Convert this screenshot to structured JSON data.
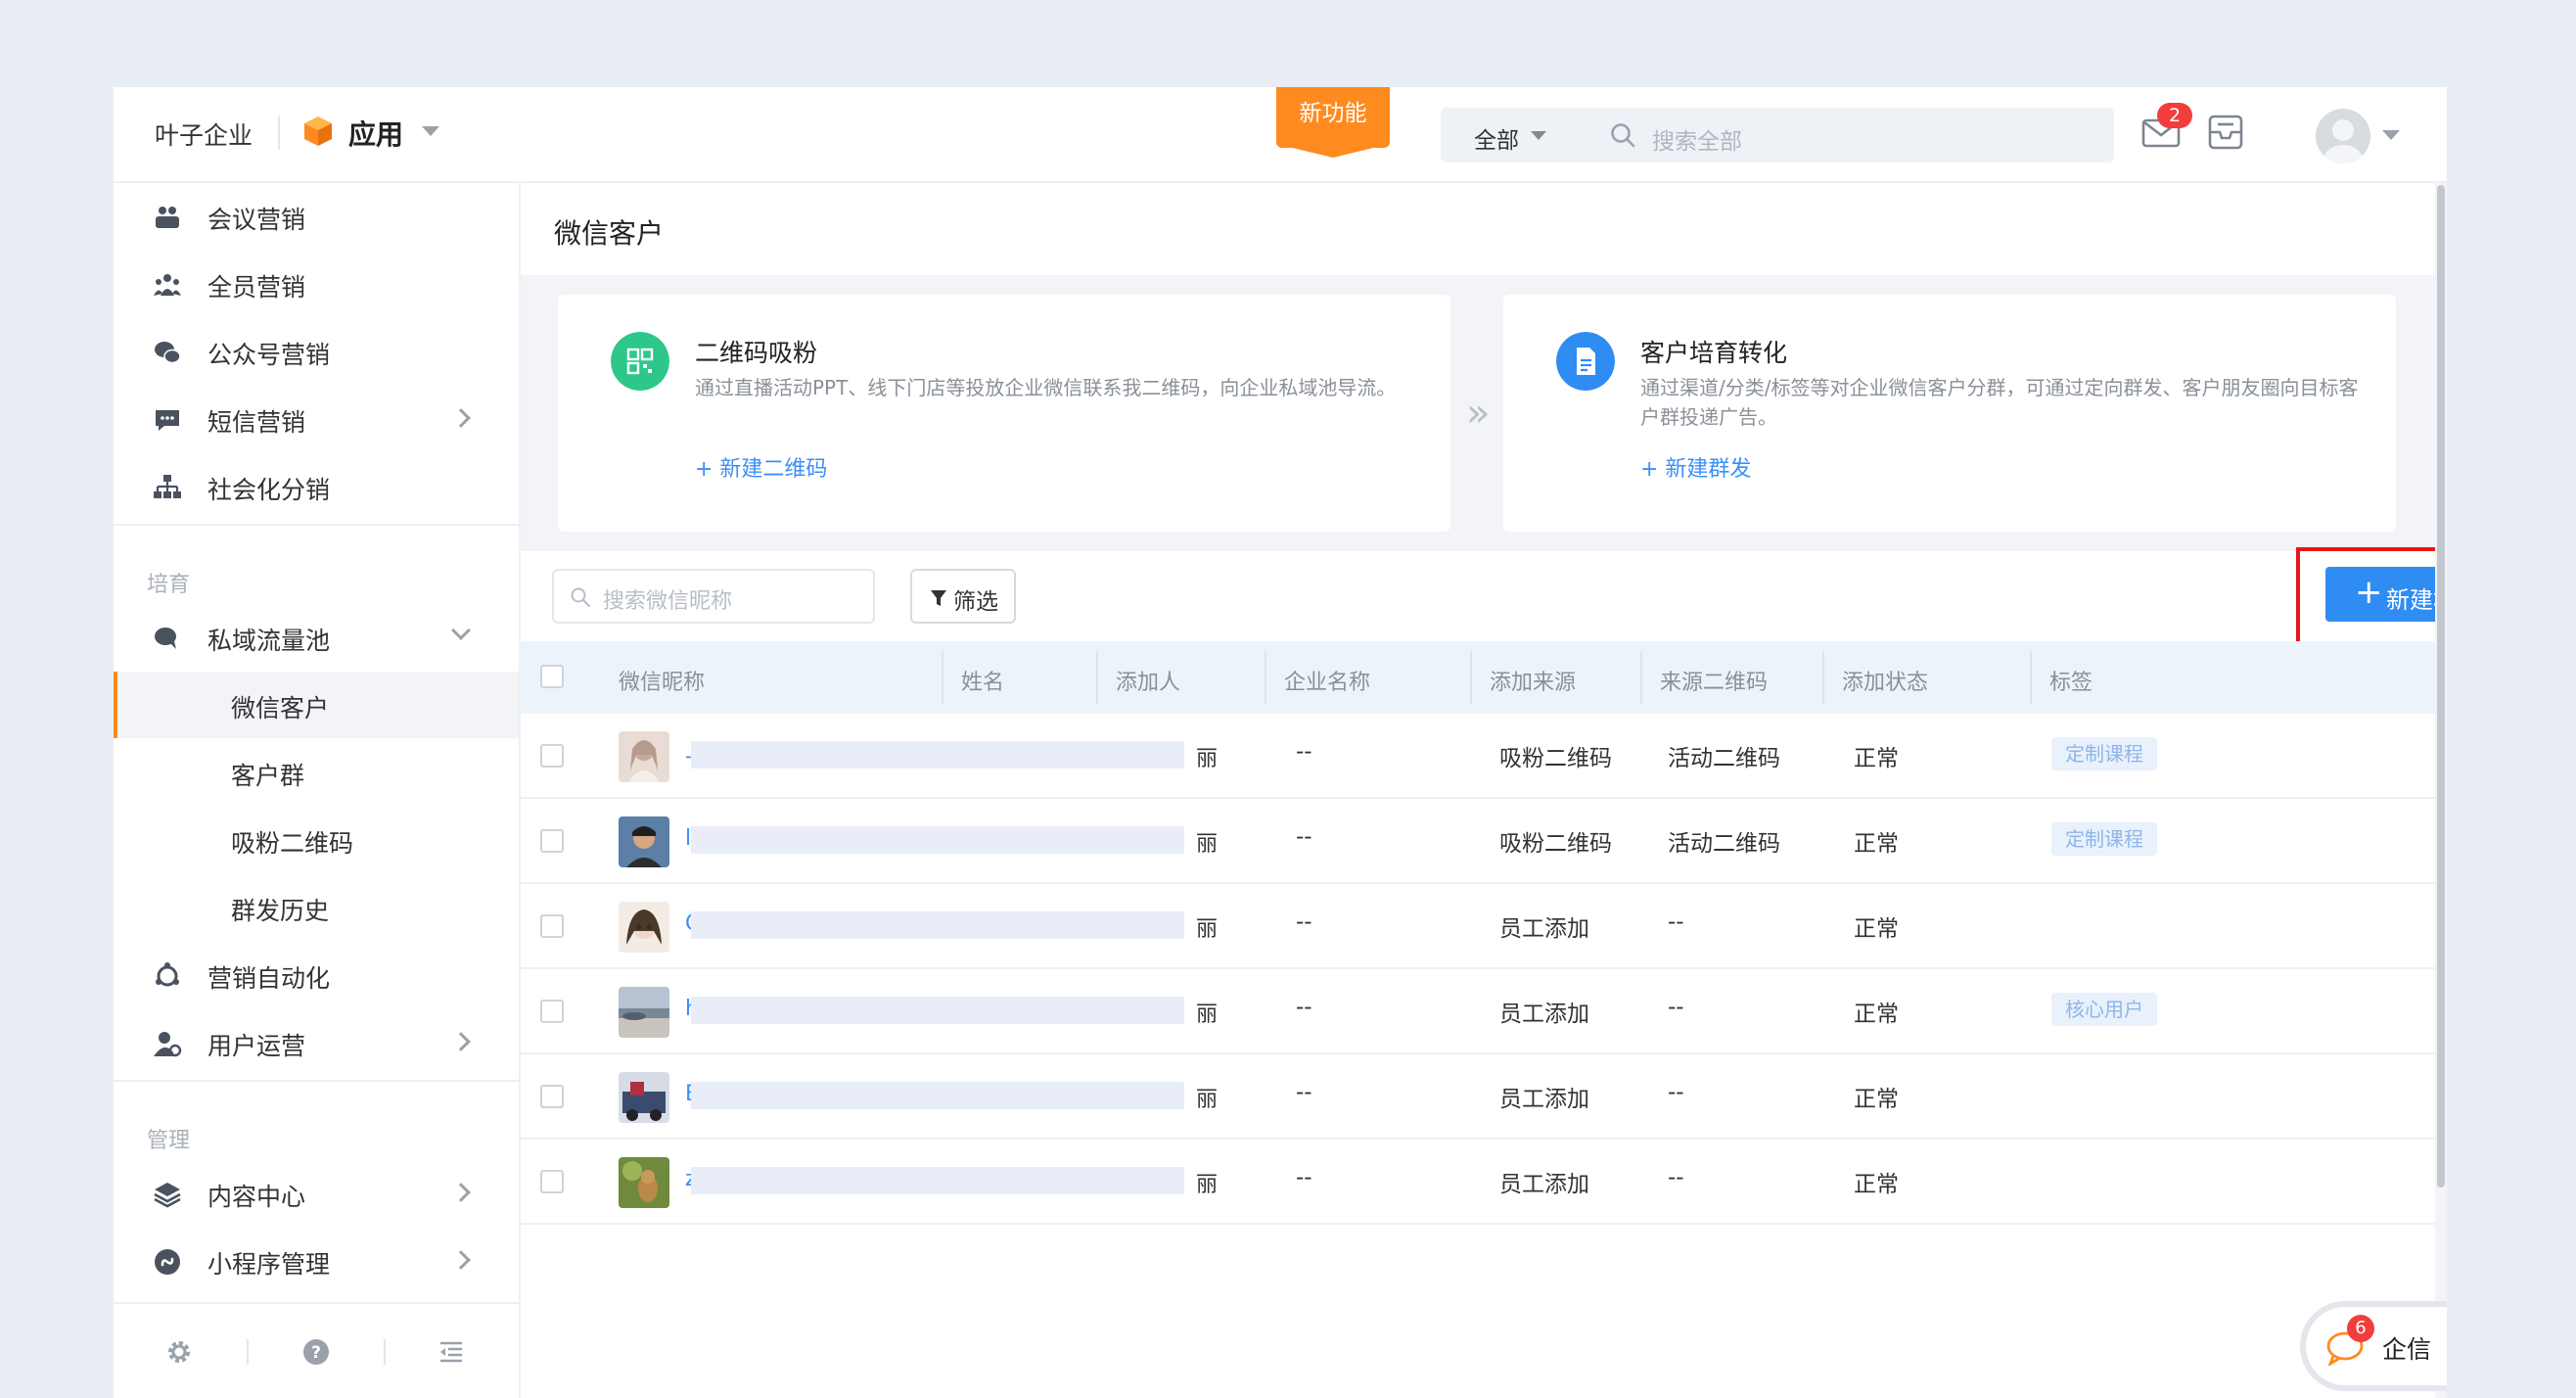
{
  "header": {
    "company": "叶子企业",
    "app_label": "应用",
    "new_feature": "新功能",
    "search_scope": "全部",
    "search_placeholder": "搜索全部",
    "mail_badge": "2"
  },
  "sidebar": {
    "top_items": [
      {
        "label": "会议营销",
        "icon": "meeting-icon"
      },
      {
        "label": "全员营销",
        "icon": "team-icon"
      },
      {
        "label": "公众号营销",
        "icon": "wechat-icon"
      },
      {
        "label": "短信营销",
        "icon": "sms-icon"
      },
      {
        "label": "社会化分销",
        "icon": "org-chart-icon"
      }
    ],
    "section_nurture": "培育",
    "private_pool": "私域流量池",
    "sub_items": [
      "微信客户",
      "客户群",
      "吸粉二维码",
      "群发历史"
    ],
    "automation": "营销自动化",
    "user_ops": "用户运营",
    "section_manage": "管理",
    "content_center": "内容中心",
    "miniprogram": "小程序管理"
  },
  "main": {
    "page_title": "微信客户",
    "card_qr": {
      "title": "二维码吸粉",
      "desc": "通过直播活动PPT、线下门店等投放企业微信联系我二维码，向企业私域池导流。",
      "link": "+ 新建二维码"
    },
    "card_nurture": {
      "title": "客户培育转化",
      "desc": "通过渠道/分类/标签等对企业微信客户分群，可通过定向群发、客户朋友圈向目标客户群投递广告。",
      "link": "+ 新建群发"
    },
    "arrows": "»",
    "search_placeholder": "搜索微信昵称",
    "filter_label": "筛选",
    "new_broadcast": "新建群发"
  },
  "table": {
    "columns": [
      "微信昵称",
      "姓名",
      "添加人",
      "企业名称",
      "添加来源",
      "来源二维码",
      "添加状态",
      "标签"
    ],
    "rows": [
      {
        "nick": "一",
        "adder": "丽",
        "company": "--",
        "source": "吸粉二维码",
        "qr": "活动二维码",
        "status": "正常",
        "tag": "定制课程"
      },
      {
        "nick": "li",
        "adder": "丽",
        "company": "--",
        "source": "吸粉二维码",
        "qr": "活动二维码",
        "status": "正常",
        "tag": "定制课程"
      },
      {
        "nick": "G",
        "adder": "丽",
        "company": "--",
        "source": "员工添加",
        "qr": "--",
        "status": "正常",
        "tag": ""
      },
      {
        "nick": "h",
        "adder": "丽",
        "company": "--",
        "source": "员工添加",
        "qr": "--",
        "status": "正常",
        "tag": "核心用户"
      },
      {
        "nick": "B",
        "adder": "丽",
        "company": "--",
        "source": "员工添加",
        "qr": "--",
        "status": "正常",
        "tag": ""
      },
      {
        "nick": "z",
        "adder": "丽",
        "company": "--",
        "source": "员工添加",
        "qr": "--",
        "status": "正常",
        "tag": ""
      }
    ]
  },
  "qixin": {
    "label": "企信",
    "badge": "6"
  },
  "colors": {
    "accent": "#2f8cf3",
    "brand_orange": "#ff8a1f",
    "highlight_red": "#e8161b",
    "badge_red": "#f23d3d"
  }
}
